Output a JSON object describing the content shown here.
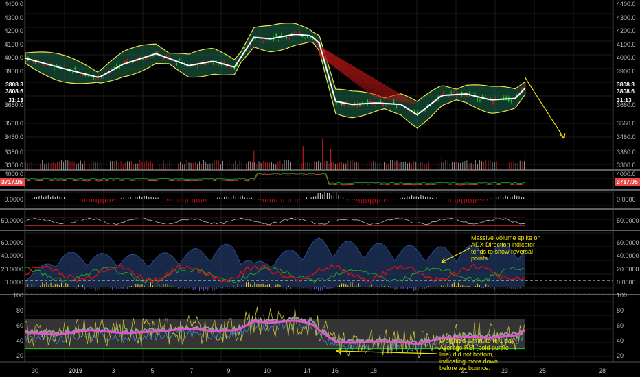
{
  "colors": {
    "background": "#000000",
    "grid": "#1c1c1c",
    "separator": "#bdbdbd",
    "bull": "#1fd11f",
    "bear": "#d11818",
    "ribbon_green": "#1d6b4e",
    "ribbon_red": "#b01515",
    "band": "#efe44a",
    "adx_fill": "#1f3560",
    "adx_green": "#23a123",
    "adx_red": "#e01010",
    "rsi_weighted": "#e055d0",
    "rsi_gray": "#9a9a9a",
    "rsi_fast": "#c9c33c",
    "rsi_blue": "#3b8fd0",
    "annotation": "#f3e600",
    "price_tag": "#e84a4a"
  },
  "price_tags": {
    "last": "3808.3",
    "prev": "3808.6",
    "countdown": "31:13",
    "ma_tag": "3717.95"
  },
  "annotations": {
    "volume_spike": [
      "Massive Volume spike on",
      "ADX Direction indicator",
      "tends to show reversal",
      "points."
    ],
    "rsi_note": [
      "Weighted 1 minute to 1 day",
      "Average RSI (bold purple",
      "line) did not bottom,",
      "indicating more down",
      "before we bounce."
    ]
  },
  "chart_data": [
    {
      "type": "candlestick",
      "panel": "price",
      "ylim": [
        3260,
        4400
      ],
      "yticks": [
        "4400.0",
        "4300.0",
        "4200.0",
        "4100.0",
        "4000.0",
        "3900.0",
        "3808.3",
        "3808.6",
        "3660.0",
        "3560.0",
        "3460.0",
        "3380.0",
        "3300.0"
      ],
      "x_labels": [
        "30",
        "2019",
        "3",
        "5",
        "7",
        "9",
        "10",
        "14",
        "16",
        "18",
        "21",
        "23",
        "25",
        "28"
      ],
      "trend": [
        [
          0,
          4010
        ],
        [
          20,
          3950
        ],
        [
          45,
          3880
        ],
        [
          60,
          3970
        ],
        [
          80,
          4040
        ],
        [
          100,
          3960
        ],
        [
          115,
          3990
        ],
        [
          128,
          3950
        ],
        [
          140,
          4150
        ],
        [
          150,
          4140
        ],
        [
          165,
          4170
        ],
        [
          175,
          4160
        ],
        [
          180,
          4110
        ],
        [
          190,
          3720
        ],
        [
          200,
          3700
        ],
        [
          215,
          3710
        ],
        [
          230,
          3700
        ],
        [
          240,
          3630
        ],
        [
          255,
          3760
        ],
        [
          270,
          3770
        ],
        [
          285,
          3730
        ],
        [
          300,
          3740
        ],
        [
          306,
          3808
        ]
      ],
      "projection": [
        [
          306,
          3880
        ],
        [
          330,
          3470
        ]
      ],
      "volume_spikes": [
        [
          140,
          3390
        ],
        [
          170,
          3420
        ],
        [
          182,
          3470
        ],
        [
          187,
          3400
        ],
        [
          255,
          3360
        ],
        [
          306,
          3390
        ]
      ]
    },
    {
      "type": "line",
      "panel": "moving-average",
      "ylim": [
        3500,
        4200
      ],
      "yticks": [
        "4000.0",
        "3717.95"
      ]
    },
    {
      "type": "bar",
      "panel": "momentum",
      "yticks": [
        "0.0000"
      ]
    },
    {
      "type": "line",
      "panel": "oscillator",
      "ylim": [
        30,
        80
      ],
      "yticks": [
        "50.0000"
      ],
      "levels": [
        62,
        42
      ]
    },
    {
      "type": "area",
      "panel": "adx",
      "ylim": [
        -10,
        70
      ],
      "yticks": [
        "60.0000",
        "40.0000",
        "20.0000",
        "0.0000"
      ],
      "levels": [
        8,
        -8
      ],
      "adx_peaks": [
        [
          22,
          44
        ],
        [
          75,
          40
        ],
        [
          128,
          55
        ],
        [
          140,
          30
        ],
        [
          180,
          62
        ],
        [
          195,
          58
        ],
        [
          250,
          50
        ],
        [
          306,
          55
        ]
      ]
    },
    {
      "type": "line",
      "panel": "rsi",
      "ylim": [
        12,
        102
      ],
      "yticks": [
        "100",
        "80",
        "60",
        "40",
        "20"
      ],
      "bands": [
        70,
        30
      ],
      "weighted_rsi": [
        [
          0,
          52
        ],
        [
          20,
          49
        ],
        [
          40,
          55
        ],
        [
          60,
          51
        ],
        [
          80,
          53
        ],
        [
          100,
          57
        ],
        [
          115,
          54
        ],
        [
          130,
          55
        ],
        [
          140,
          67
        ],
        [
          150,
          65
        ],
        [
          165,
          68
        ],
        [
          175,
          64
        ],
        [
          180,
          55
        ],
        [
          190,
          39
        ],
        [
          200,
          38
        ],
        [
          215,
          40
        ],
        [
          230,
          39
        ],
        [
          240,
          36
        ],
        [
          255,
          44
        ],
        [
          270,
          46
        ],
        [
          285,
          45
        ],
        [
          300,
          48
        ],
        [
          306,
          55
        ]
      ]
    }
  ]
}
